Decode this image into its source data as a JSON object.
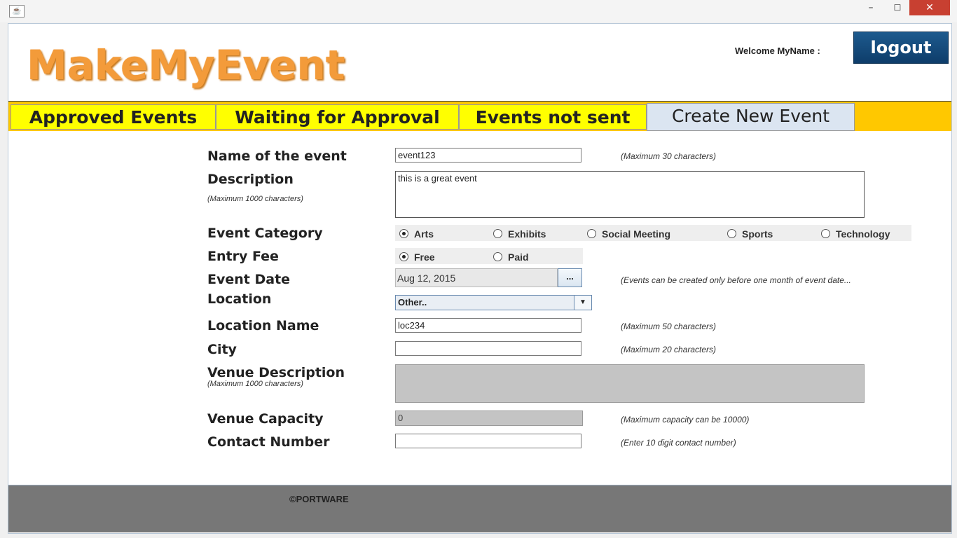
{
  "window": {
    "icon": "java-cup-icon",
    "minimize": "–",
    "maximize": "☐",
    "close": "✕"
  },
  "header": {
    "logo": "MakeMyEvent",
    "welcome": "Welcome MyName :",
    "logout_label": "logout"
  },
  "tabs": [
    {
      "label": "Approved Events",
      "active": false
    },
    {
      "label": "Waiting for Approval",
      "active": false
    },
    {
      "label": "Events not sent",
      "active": false
    },
    {
      "label": "Create New Event",
      "active": true
    }
  ],
  "form": {
    "name": {
      "label": "Name of the event",
      "value": "event123",
      "hint": "(Maximum 30 characters)"
    },
    "description": {
      "label": "Description",
      "sublabel": "(Maximum 1000 characters)",
      "value": "this is a great event"
    },
    "category": {
      "label": "Event Category",
      "options": [
        "Arts",
        "Exhibits",
        "Social Meeting",
        "Sports",
        "Technology"
      ],
      "selected": "Arts"
    },
    "fee": {
      "label": "Entry Fee",
      "options": [
        "Free",
        "Paid"
      ],
      "selected": "Free"
    },
    "date": {
      "label": "Event Date",
      "value": "Aug 12, 2015",
      "button": "...",
      "hint": "(Events can be created only before one month of event date..."
    },
    "location": {
      "label": "Location",
      "value": "Other.."
    },
    "location_name": {
      "label": "Location Name",
      "value": "loc234",
      "hint": "(Maximum 50 characters)"
    },
    "city": {
      "label": "City",
      "value": "",
      "hint": "(Maximum 20 characters)"
    },
    "venue_description": {
      "label": "Venue Description",
      "sublabel": "(Maximum 1000 characters)",
      "value": ""
    },
    "venue_capacity": {
      "label": "Venue Capacity",
      "value": "0",
      "hint": "(Maximum capacity can be 10000)"
    },
    "contact": {
      "label": "Contact Number",
      "value": "",
      "hint": "(Enter 10 digit contact number)"
    }
  },
  "footer": {
    "copyright": "©PORTWARE"
  }
}
